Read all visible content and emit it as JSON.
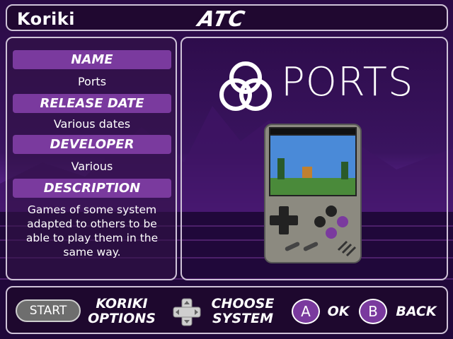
{
  "header": {
    "app_name": "Koriki",
    "logo_text": "ATC"
  },
  "info": {
    "name_label": "NAME",
    "name_value": "Ports",
    "release_label": "RELEASE DATE",
    "release_value": "Various dates",
    "developer_label": "DEVELOPER",
    "developer_value": "Various",
    "description_label": "DESCRIPTION",
    "description_value": "Games of some system adapted to others to be able to play them in the same way."
  },
  "preview": {
    "system_title": "PORTS",
    "icon": "ports-trefoil-icon",
    "device": "handheld-console-image"
  },
  "footer": {
    "start_label": "START",
    "koriki_options_line1": "KORIKI",
    "koriki_options_line2": "OPTIONS",
    "dpad_icon": "dpad-icon",
    "choose_line1": "CHOOSE",
    "choose_line2": "SYSTEM",
    "a_button": "A",
    "ok_label": "OK",
    "b_button": "B",
    "back_label": "BACK"
  },
  "colors": {
    "accent": "#7a3a9e",
    "panel_border": "#cfc3d8",
    "background": "#1a0630"
  }
}
